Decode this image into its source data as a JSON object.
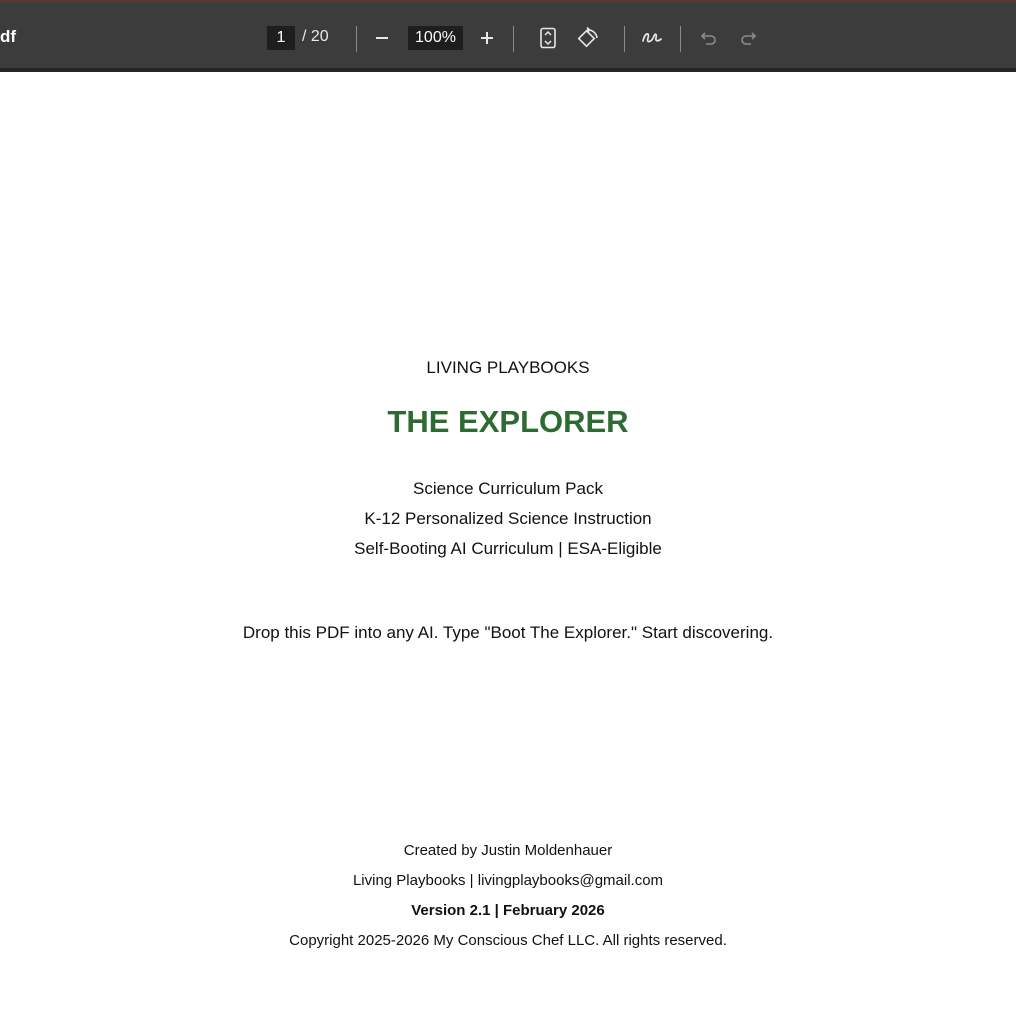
{
  "toolbar": {
    "file_name": "df",
    "current_page": "1",
    "page_total": "/ 20",
    "zoom": "100%",
    "icons": [
      "minus-icon",
      "plus-icon",
      "fit-page-icon",
      "rotate-icon",
      "draw-icon",
      "undo-icon",
      "redo-icon"
    ]
  },
  "document": {
    "brand": "LIVING PLAYBOOKS",
    "title": "THE EXPLORER",
    "title_color": "#2e6b32",
    "subtitle_1": "Science Curriculum Pack",
    "subtitle_2": "K-12 Personalized Science Instruction",
    "subtitle_3": "Self-Booting AI Curriculum | ESA-Eligible",
    "instruction": "Drop this PDF into any AI. Type \"Boot The Explorer.\" Start discovering.",
    "created_by": "Created by Justin Moldenhauer",
    "contact": "Living Playbooks | livingplaybooks@gmail.com",
    "version": "Version 2.1 | February 2026",
    "copyright": "Copyright 2025-2026 My Conscious Chef LLC. All rights reserved."
  }
}
